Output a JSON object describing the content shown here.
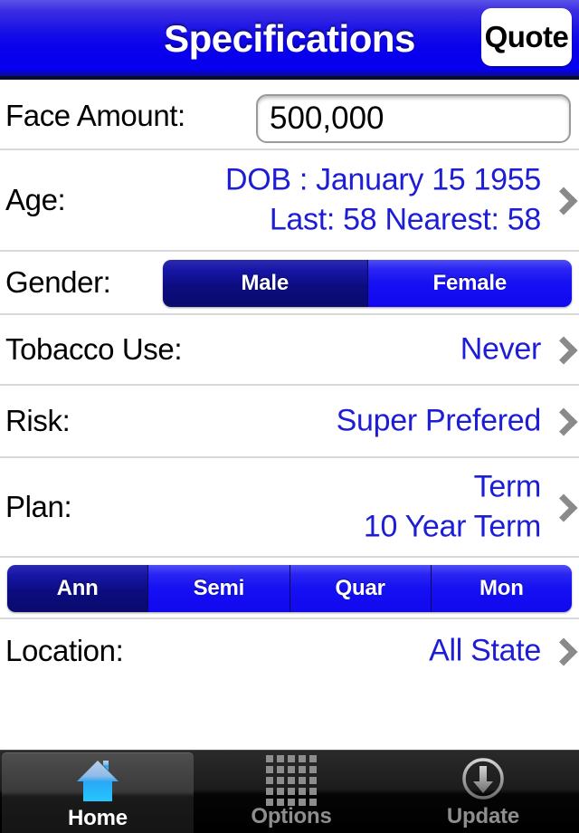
{
  "header": {
    "title": "Specifications",
    "quote_label": "Quote"
  },
  "form": {
    "face_amount": {
      "label": "Face Amount:",
      "value": "500,000",
      "placeholder": "Face Amount"
    },
    "age": {
      "label": "Age:",
      "line1": "DOB : January 15 1955",
      "line2": "Last: 58  Nearest: 58"
    },
    "gender": {
      "label": "Gender:",
      "options": [
        "Male",
        "Female"
      ],
      "selected": "Male"
    },
    "tobacco": {
      "label": "Tobacco Use:",
      "value": "Never"
    },
    "risk": {
      "label": "Risk:",
      "value": "Super Prefered"
    },
    "plan": {
      "label": "Plan:",
      "line1": "Term",
      "line2": "10 Year Term"
    },
    "frequency": {
      "options": [
        "Ann",
        "Semi",
        "Quar",
        "Mon"
      ],
      "selected": "Ann"
    },
    "location": {
      "label": "Location:",
      "value": "All State"
    }
  },
  "tabbar": {
    "tabs": [
      {
        "label": "Home",
        "icon": "house-icon",
        "active": true
      },
      {
        "label": "Options",
        "icon": "grid-icon",
        "active": false
      },
      {
        "label": "Update",
        "icon": "download-arrow-icon",
        "active": false
      }
    ]
  },
  "colors": {
    "header_blue": "#0600ee",
    "value_blue": "#1d1dd6",
    "segment_selected": "#0c0c80",
    "segment_unselected": "#1510f2",
    "tabbar_bg": "#000000",
    "active_tab_text": "#ffffff",
    "inactive_tab_text": "#8e8e8e"
  }
}
